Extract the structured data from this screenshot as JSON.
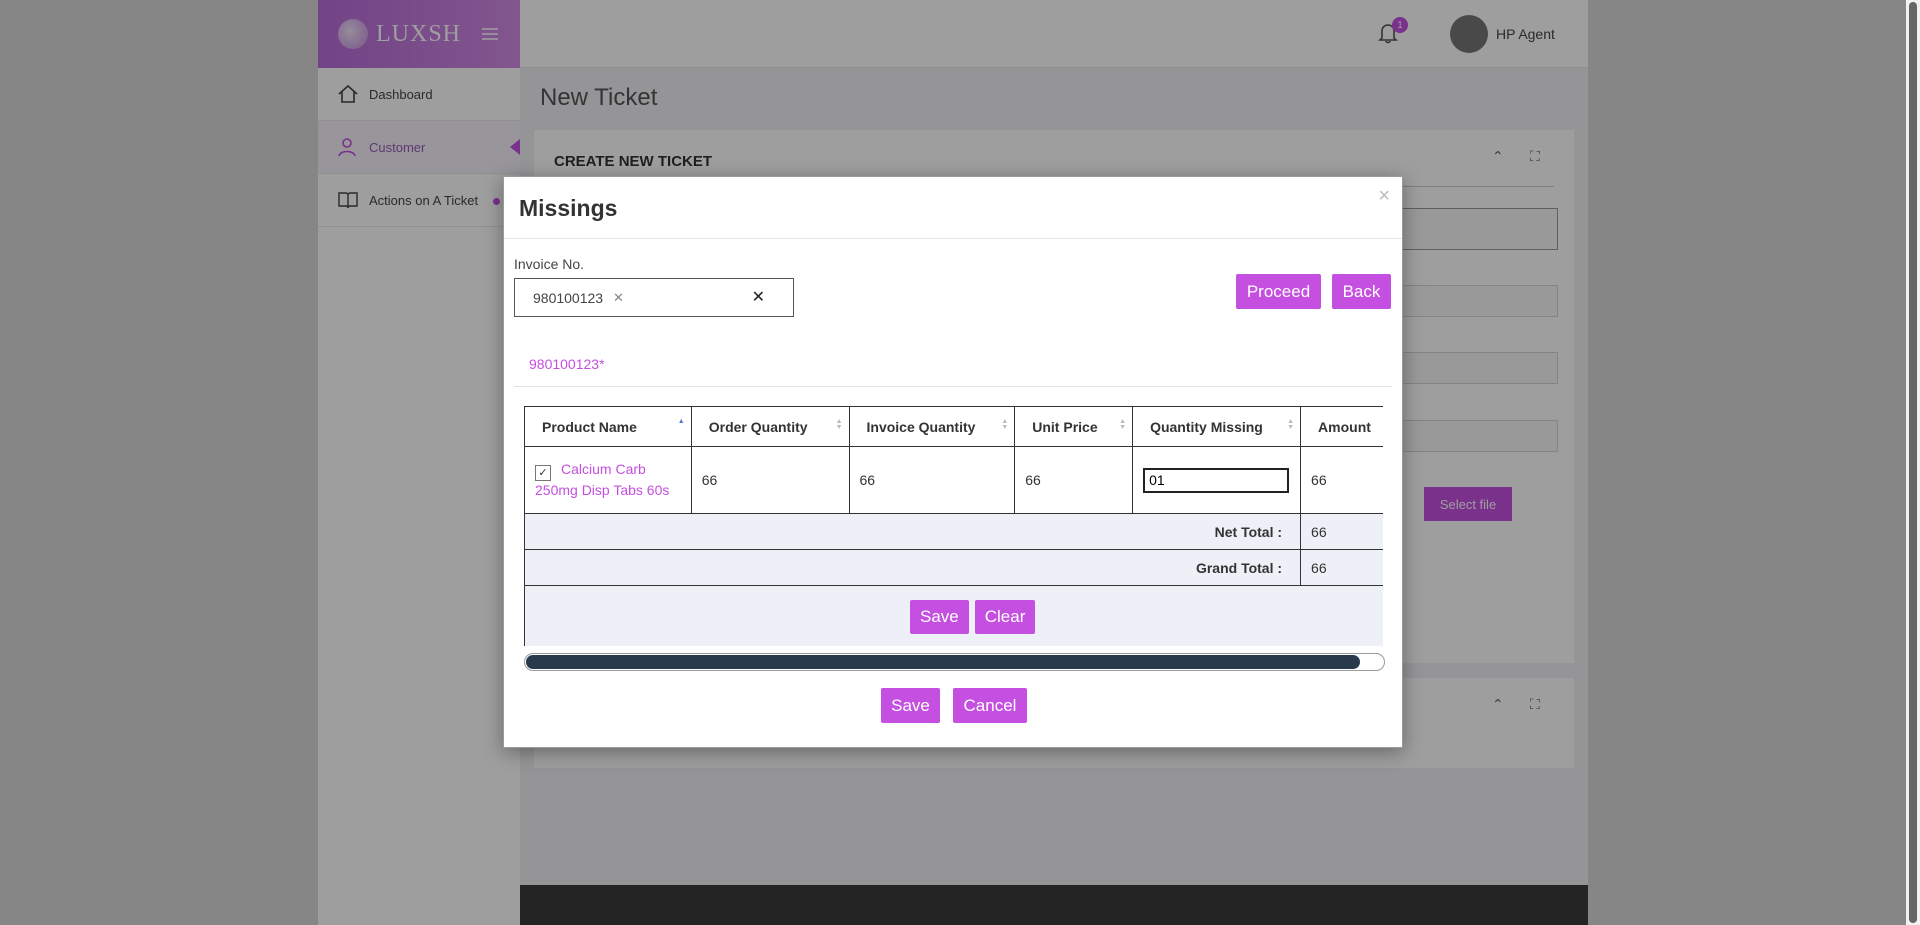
{
  "brand": {
    "logo_text": "LUXSH"
  },
  "sidebar": {
    "items": [
      {
        "label": "Dashboard",
        "icon": "home-icon"
      },
      {
        "label": "Customer",
        "icon": "user-icon"
      },
      {
        "label": "Actions on A Ticket",
        "icon": "book-icon"
      }
    ]
  },
  "header": {
    "notification_count": "1",
    "user_name": "HP Agent"
  },
  "page": {
    "title": "New Ticket",
    "card_title": "CREATE NEW TICKET",
    "select_file_label": "Select file"
  },
  "modal": {
    "title": "Missings",
    "close_label": "×",
    "invoice_label": "Invoice No.",
    "invoice_tag": "980100123",
    "proceed_label": "Proceed",
    "back_label": "Back",
    "invoice_link": "980100123*",
    "table": {
      "headers": [
        "Product Name",
        "Order Quantity",
        "Invoice Quantity",
        "Unit Price",
        "Quantity Missing",
        "Amount"
      ],
      "rows": [
        {
          "product": "Calcium Carb 250mg Disp Tabs 60s",
          "order_qty": "66",
          "invoice_qty": "66",
          "unit_price": "66",
          "qty_missing": "01",
          "amount": "66"
        }
      ],
      "net_total_label": "Net Total :",
      "net_total": "66",
      "grand_total_label": "Grand Total :",
      "grand_total": "66",
      "save_label": "Save",
      "clear_label": "Clear"
    },
    "scroll_progress": 0.97,
    "save_label": "Save",
    "cancel_label": "Cancel"
  },
  "colors": {
    "accent": "#c54fe0",
    "scroll_thumb": "#2a3a4d",
    "total_row_bg": "#eef0f7"
  }
}
